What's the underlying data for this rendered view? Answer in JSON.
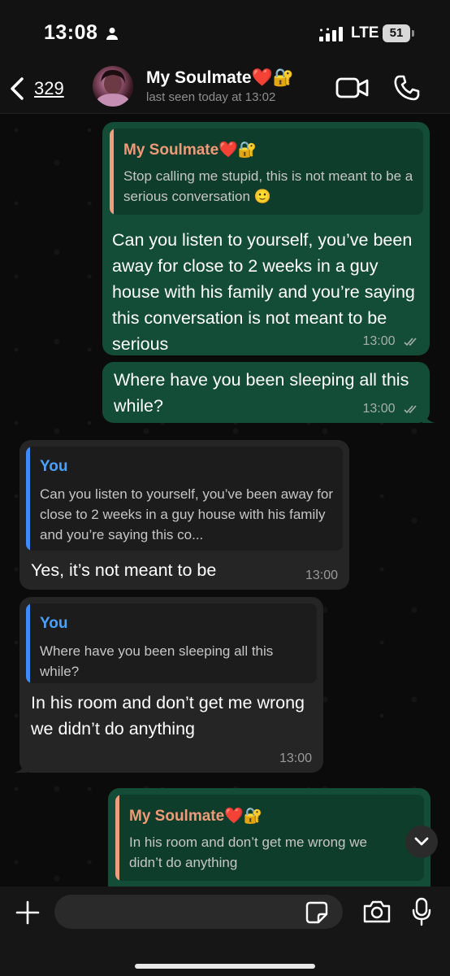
{
  "status_bar": {
    "time": "13:08",
    "network": "LTE",
    "battery": "51"
  },
  "header": {
    "back_count": "329",
    "contact_name": "My Soulmate❤️🔐",
    "contact_status": "last seen today at 13:02"
  },
  "messages": [
    {
      "direction": "outgoing",
      "reply_to_name": "My Soulmate❤️🔐",
      "reply_to_text": "Stop calling me stupid, this is not meant to be a serious conversation 🙂",
      "text": "Can you listen to yourself, you’ve been away for close to 2 weeks in a guy house with his family and you’re saying this conversation is not meant to be serious",
      "time": "13:00"
    },
    {
      "direction": "outgoing",
      "text": "Where have you been sleeping all this while?",
      "time": "13:00"
    },
    {
      "direction": "incoming",
      "reply_to_name": "You",
      "reply_to_text": "Can you listen to yourself, you’ve been away for close to 2 weeks in a guy house with his family and you’re saying this co...",
      "text": "Yes, it’s not meant to be",
      "time": "13:00"
    },
    {
      "direction": "incoming",
      "reply_to_name": "You",
      "reply_to_text": "Where have you been sleeping all this while?",
      "text": "In his room and don’t get me wrong we didn’t do anything",
      "time": "13:00"
    },
    {
      "direction": "outgoing",
      "reply_to_name": "My Soulmate❤️🔐",
      "reply_to_text": "In his room and don’t get me wrong we didn’t do anything",
      "text": "",
      "time": ""
    }
  ],
  "input": {
    "placeholder": ""
  },
  "colors": {
    "outgoing_bubble": "#134d37",
    "incoming_bubble": "#252525",
    "reply_name_outgoing": "#f09a77",
    "reply_name_incoming": "#4aa0ff"
  }
}
